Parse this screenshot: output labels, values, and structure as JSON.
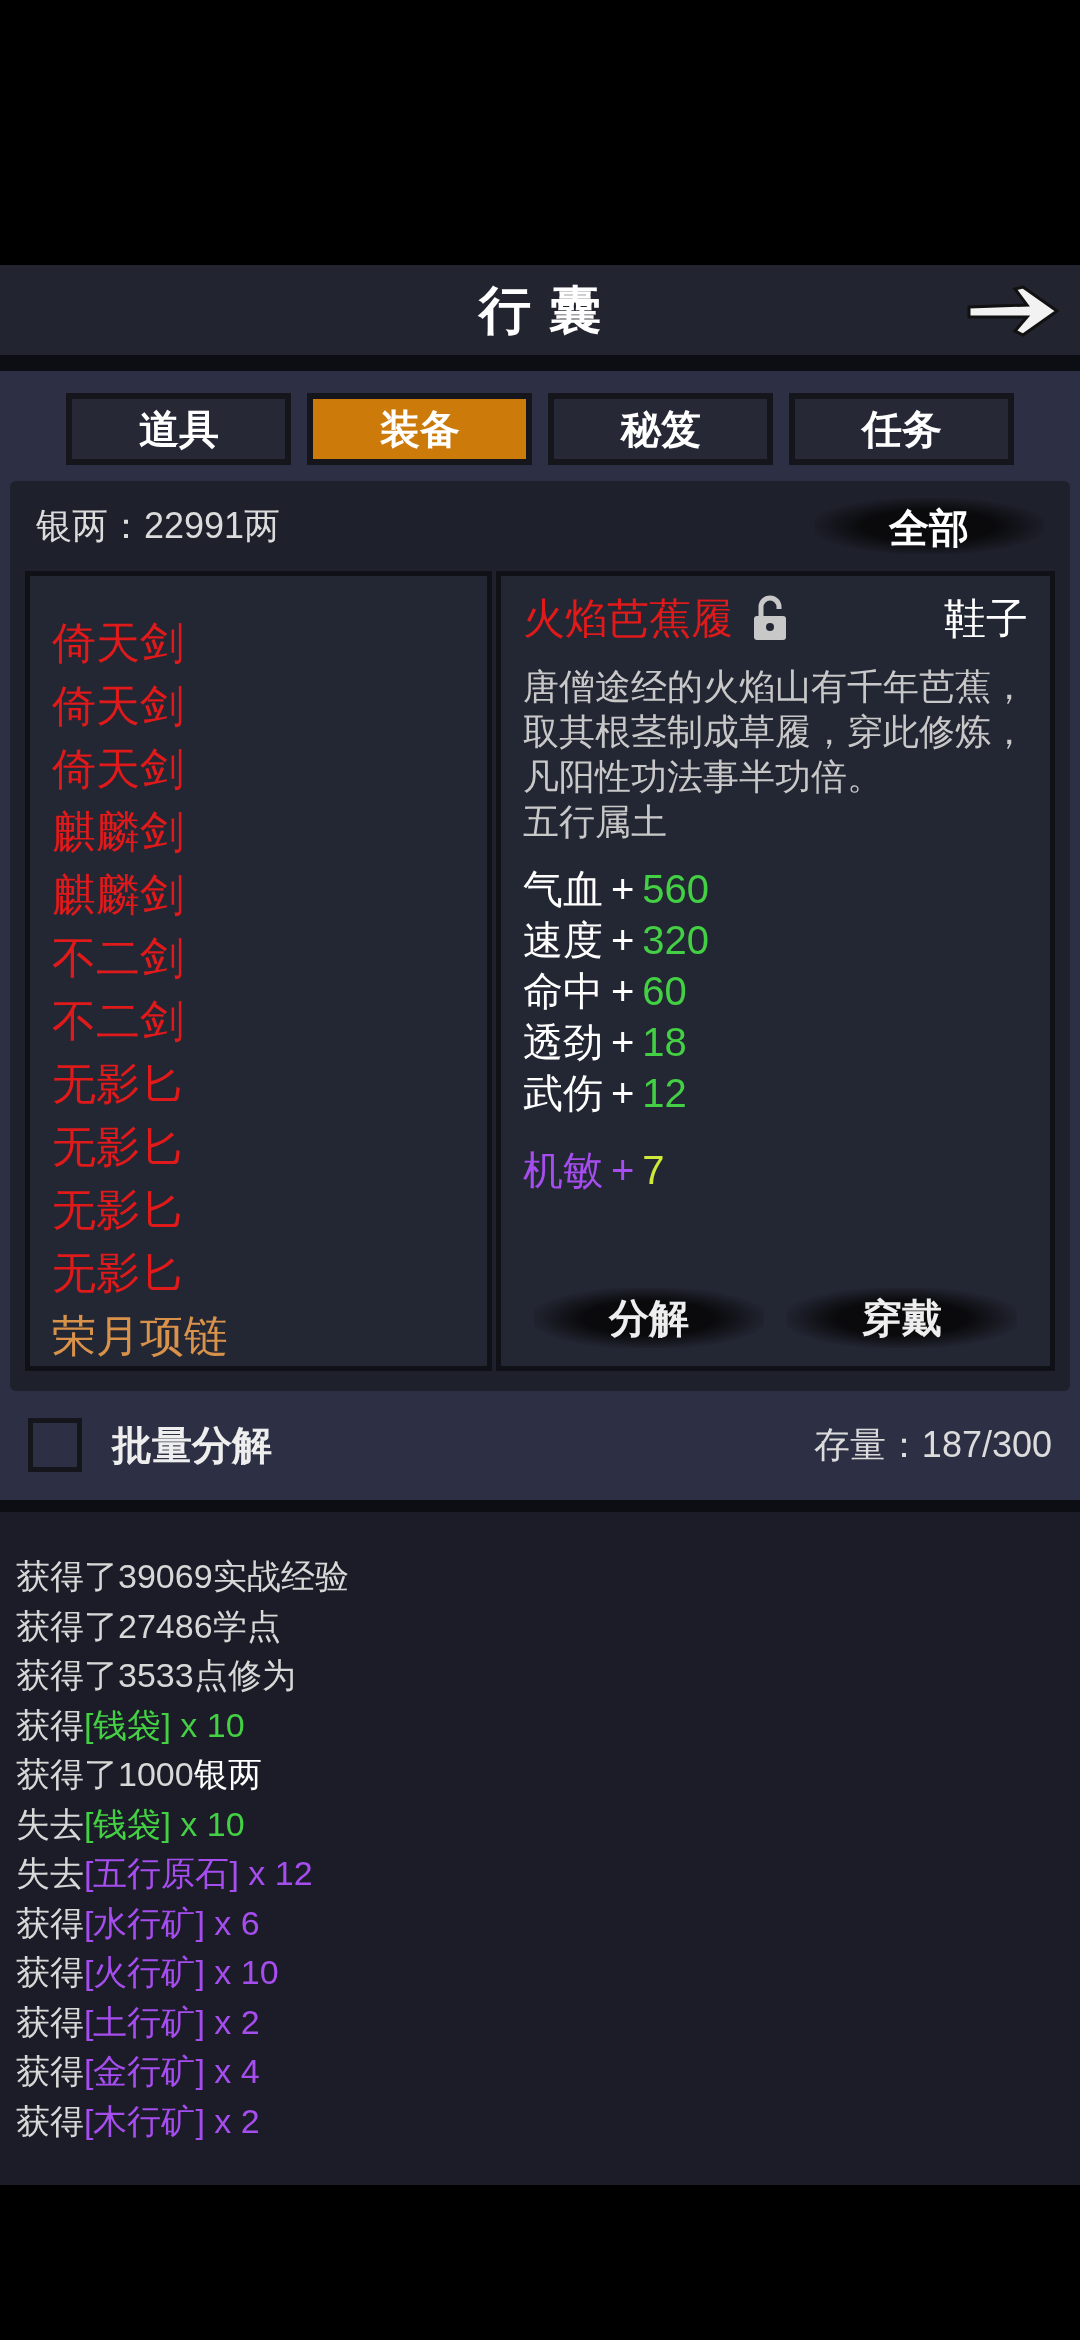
{
  "header": {
    "title": "行 囊"
  },
  "tabs": [
    {
      "label": "道具",
      "selected": false
    },
    {
      "label": "装备",
      "selected": true
    },
    {
      "label": "秘笈",
      "selected": false
    },
    {
      "label": "任务",
      "selected": false
    }
  ],
  "silver": "银两：22991两",
  "filter_button": "全部",
  "items": [
    {
      "name": "倚天剑",
      "color": "#e01a1a"
    },
    {
      "name": "倚天剑",
      "color": "#e01a1a"
    },
    {
      "name": "倚天剑",
      "color": "#e01a1a"
    },
    {
      "name": "麒麟剑",
      "color": "#e01a1a"
    },
    {
      "name": "麒麟剑",
      "color": "#e01a1a"
    },
    {
      "name": "不二剑",
      "color": "#e01a1a"
    },
    {
      "name": "不二剑",
      "color": "#e01a1a"
    },
    {
      "name": "无影匕",
      "color": "#e01a1a"
    },
    {
      "name": "无影匕",
      "color": "#e01a1a"
    },
    {
      "name": "无影匕",
      "color": "#e01a1a"
    },
    {
      "name": "无影匕",
      "color": "#e01a1a"
    },
    {
      "name": "荣月项链",
      "color": "#d8924a"
    }
  ],
  "detail": {
    "name": "火焰芭蕉履",
    "locked": false,
    "slot": "鞋子",
    "description": "唐僧途经的火焰山有千年芭蕉，取其根茎制成草履，穿此修炼，凡阳性功法事半功倍。",
    "element": "五行属土",
    "stats": [
      {
        "label": "气血",
        "sign": "+",
        "value": "560",
        "kind": "base"
      },
      {
        "label": "速度",
        "sign": "+",
        "value": "320",
        "kind": "base"
      },
      {
        "label": "命中",
        "sign": "+",
        "value": "60",
        "kind": "base"
      },
      {
        "label": "透劲",
        "sign": "+",
        "value": "18",
        "kind": "base"
      },
      {
        "label": "武伤",
        "sign": "+",
        "value": "12",
        "kind": "base"
      },
      {
        "label": "机敏",
        "sign": "+",
        "value": "7",
        "kind": "extra"
      }
    ],
    "buttons": [
      "分解",
      "穿戴"
    ]
  },
  "batch": {
    "label": "批量分解",
    "checked": false
  },
  "capacity": "存量：187/300",
  "log": [
    {
      "parts": [
        {
          "text": "获得了39069实战经验",
          "color": "#d8d8d8"
        }
      ]
    },
    {
      "parts": [
        {
          "text": "获得了27486学点",
          "color": "#d8d8d8"
        }
      ]
    },
    {
      "parts": [
        {
          "text": "获得了3533点修为",
          "color": "#d8d8d8"
        }
      ]
    },
    {
      "parts": [
        {
          "text": "获得",
          "color": "#d8d8d8"
        },
        {
          "text": "[钱袋] x 10",
          "color": "#44d044"
        }
      ]
    },
    {
      "parts": [
        {
          "text": "获得了1000",
          "color": "#d8d8d8"
        },
        {
          "text": "银两",
          "color": "#ffffff"
        }
      ]
    },
    {
      "parts": [
        {
          "text": "失去",
          "color": "#d8d8d8"
        },
        {
          "text": "[钱袋] x 10",
          "color": "#44d044"
        }
      ]
    },
    {
      "parts": [
        {
          "text": "失去",
          "color": "#d8d8d8"
        },
        {
          "text": "[五行原石] x 12",
          "color": "#a64df0"
        }
      ]
    },
    {
      "parts": [
        {
          "text": "获得",
          "color": "#d8d8d8"
        },
        {
          "text": "[水行矿] x 6",
          "color": "#a64df0"
        }
      ]
    },
    {
      "parts": [
        {
          "text": "获得",
          "color": "#d8d8d8"
        },
        {
          "text": "[火行矿] x 10",
          "color": "#a64df0"
        }
      ]
    },
    {
      "parts": [
        {
          "text": "获得",
          "color": "#d8d8d8"
        },
        {
          "text": "[土行矿] x 2",
          "color": "#a64df0"
        }
      ]
    },
    {
      "parts": [
        {
          "text": "获得",
          "color": "#d8d8d8"
        },
        {
          "text": "[金行矿] x 4",
          "color": "#a64df0"
        }
      ]
    },
    {
      "parts": [
        {
          "text": "获得",
          "color": "#d8d8d8"
        },
        {
          "text": "[木行矿] x 2",
          "color": "#a64df0"
        }
      ]
    }
  ]
}
